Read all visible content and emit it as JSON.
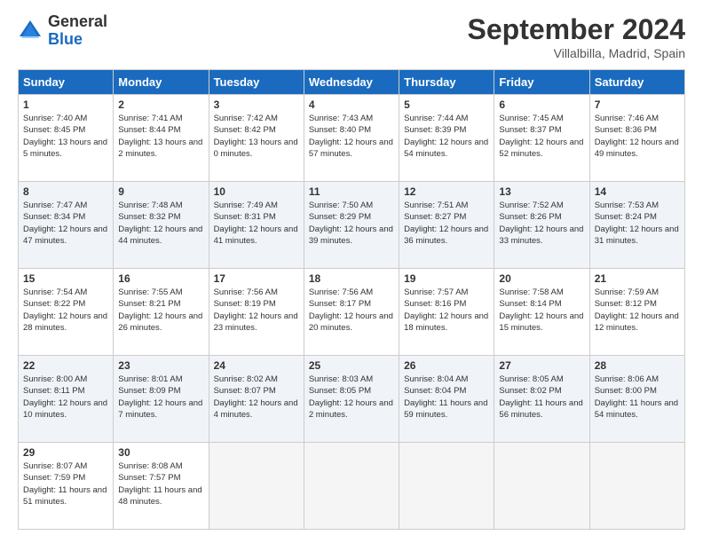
{
  "header": {
    "logo_general": "General",
    "logo_blue": "Blue",
    "month_title": "September 2024",
    "location": "Villalbilla, Madrid, Spain"
  },
  "columns": [
    "Sunday",
    "Monday",
    "Tuesday",
    "Wednesday",
    "Thursday",
    "Friday",
    "Saturday"
  ],
  "weeks": [
    [
      {
        "day": "1",
        "sunrise": "Sunrise: 7:40 AM",
        "sunset": "Sunset: 8:45 PM",
        "daylight": "Daylight: 13 hours and 5 minutes."
      },
      {
        "day": "2",
        "sunrise": "Sunrise: 7:41 AM",
        "sunset": "Sunset: 8:44 PM",
        "daylight": "Daylight: 13 hours and 2 minutes."
      },
      {
        "day": "3",
        "sunrise": "Sunrise: 7:42 AM",
        "sunset": "Sunset: 8:42 PM",
        "daylight": "Daylight: 13 hours and 0 minutes."
      },
      {
        "day": "4",
        "sunrise": "Sunrise: 7:43 AM",
        "sunset": "Sunset: 8:40 PM",
        "daylight": "Daylight: 12 hours and 57 minutes."
      },
      {
        "day": "5",
        "sunrise": "Sunrise: 7:44 AM",
        "sunset": "Sunset: 8:39 PM",
        "daylight": "Daylight: 12 hours and 54 minutes."
      },
      {
        "day": "6",
        "sunrise": "Sunrise: 7:45 AM",
        "sunset": "Sunset: 8:37 PM",
        "daylight": "Daylight: 12 hours and 52 minutes."
      },
      {
        "day": "7",
        "sunrise": "Sunrise: 7:46 AM",
        "sunset": "Sunset: 8:36 PM",
        "daylight": "Daylight: 12 hours and 49 minutes."
      }
    ],
    [
      {
        "day": "8",
        "sunrise": "Sunrise: 7:47 AM",
        "sunset": "Sunset: 8:34 PM",
        "daylight": "Daylight: 12 hours and 47 minutes."
      },
      {
        "day": "9",
        "sunrise": "Sunrise: 7:48 AM",
        "sunset": "Sunset: 8:32 PM",
        "daylight": "Daylight: 12 hours and 44 minutes."
      },
      {
        "day": "10",
        "sunrise": "Sunrise: 7:49 AM",
        "sunset": "Sunset: 8:31 PM",
        "daylight": "Daylight: 12 hours and 41 minutes."
      },
      {
        "day": "11",
        "sunrise": "Sunrise: 7:50 AM",
        "sunset": "Sunset: 8:29 PM",
        "daylight": "Daylight: 12 hours and 39 minutes."
      },
      {
        "day": "12",
        "sunrise": "Sunrise: 7:51 AM",
        "sunset": "Sunset: 8:27 PM",
        "daylight": "Daylight: 12 hours and 36 minutes."
      },
      {
        "day": "13",
        "sunrise": "Sunrise: 7:52 AM",
        "sunset": "Sunset: 8:26 PM",
        "daylight": "Daylight: 12 hours and 33 minutes."
      },
      {
        "day": "14",
        "sunrise": "Sunrise: 7:53 AM",
        "sunset": "Sunset: 8:24 PM",
        "daylight": "Daylight: 12 hours and 31 minutes."
      }
    ],
    [
      {
        "day": "15",
        "sunrise": "Sunrise: 7:54 AM",
        "sunset": "Sunset: 8:22 PM",
        "daylight": "Daylight: 12 hours and 28 minutes."
      },
      {
        "day": "16",
        "sunrise": "Sunrise: 7:55 AM",
        "sunset": "Sunset: 8:21 PM",
        "daylight": "Daylight: 12 hours and 26 minutes."
      },
      {
        "day": "17",
        "sunrise": "Sunrise: 7:56 AM",
        "sunset": "Sunset: 8:19 PM",
        "daylight": "Daylight: 12 hours and 23 minutes."
      },
      {
        "day": "18",
        "sunrise": "Sunrise: 7:56 AM",
        "sunset": "Sunset: 8:17 PM",
        "daylight": "Daylight: 12 hours and 20 minutes."
      },
      {
        "day": "19",
        "sunrise": "Sunrise: 7:57 AM",
        "sunset": "Sunset: 8:16 PM",
        "daylight": "Daylight: 12 hours and 18 minutes."
      },
      {
        "day": "20",
        "sunrise": "Sunrise: 7:58 AM",
        "sunset": "Sunset: 8:14 PM",
        "daylight": "Daylight: 12 hours and 15 minutes."
      },
      {
        "day": "21",
        "sunrise": "Sunrise: 7:59 AM",
        "sunset": "Sunset: 8:12 PM",
        "daylight": "Daylight: 12 hours and 12 minutes."
      }
    ],
    [
      {
        "day": "22",
        "sunrise": "Sunrise: 8:00 AM",
        "sunset": "Sunset: 8:11 PM",
        "daylight": "Daylight: 12 hours and 10 minutes."
      },
      {
        "day": "23",
        "sunrise": "Sunrise: 8:01 AM",
        "sunset": "Sunset: 8:09 PM",
        "daylight": "Daylight: 12 hours and 7 minutes."
      },
      {
        "day": "24",
        "sunrise": "Sunrise: 8:02 AM",
        "sunset": "Sunset: 8:07 PM",
        "daylight": "Daylight: 12 hours and 4 minutes."
      },
      {
        "day": "25",
        "sunrise": "Sunrise: 8:03 AM",
        "sunset": "Sunset: 8:05 PM",
        "daylight": "Daylight: 12 hours and 2 minutes."
      },
      {
        "day": "26",
        "sunrise": "Sunrise: 8:04 AM",
        "sunset": "Sunset: 8:04 PM",
        "daylight": "Daylight: 11 hours and 59 minutes."
      },
      {
        "day": "27",
        "sunrise": "Sunrise: 8:05 AM",
        "sunset": "Sunset: 8:02 PM",
        "daylight": "Daylight: 11 hours and 56 minutes."
      },
      {
        "day": "28",
        "sunrise": "Sunrise: 8:06 AM",
        "sunset": "Sunset: 8:00 PM",
        "daylight": "Daylight: 11 hours and 54 minutes."
      }
    ],
    [
      {
        "day": "29",
        "sunrise": "Sunrise: 8:07 AM",
        "sunset": "Sunset: 7:59 PM",
        "daylight": "Daylight: 11 hours and 51 minutes."
      },
      {
        "day": "30",
        "sunrise": "Sunrise: 8:08 AM",
        "sunset": "Sunset: 7:57 PM",
        "daylight": "Daylight: 11 hours and 48 minutes."
      },
      null,
      null,
      null,
      null,
      null
    ]
  ]
}
